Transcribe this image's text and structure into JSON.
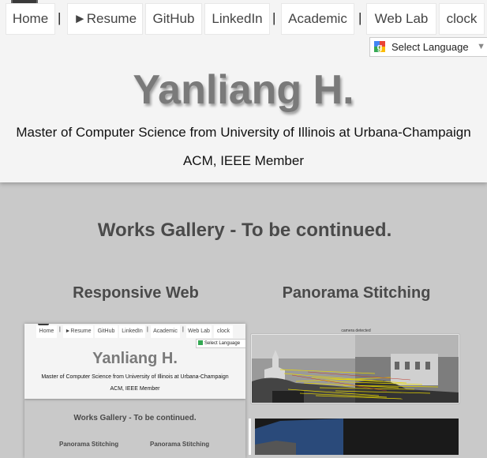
{
  "nav": {
    "items": [
      "Home",
      "►Resume",
      "GitHub",
      "LinkedIn",
      "Academic",
      "Web Lab",
      "clock"
    ],
    "separator": "|"
  },
  "language": {
    "label": "Select Language",
    "arrow": "▼"
  },
  "header": {
    "name": "Yanliang H.",
    "degree": "Master of Computer Science from University of Illinois at Urbana-Champaign",
    "member": "ACM, IEEE Member"
  },
  "gallery": {
    "title": "Works Gallery - To be continued.",
    "columns": [
      "Responsive Web",
      "Panorama Stitching"
    ]
  },
  "thumbnail_web": {
    "nav": [
      "Home",
      "►Resume",
      "GitHub",
      "LinkedIn",
      "Academic",
      "Web Lab",
      "clock"
    ],
    "language": "Select Language",
    "name": "Yanliang H.",
    "degree": "Master of Computer Science from University of Illinois at Urbana-Champaign",
    "member": "ACM, IEEE Member",
    "gallery_title": "Works Gallery - To be continued.",
    "columns": [
      "Panorama Stitching",
      "Panorama Stitching"
    ]
  },
  "thumbnail_pano": {
    "plot_title": "camera detected"
  },
  "colors": {
    "header_bg": "#f4f4f4",
    "page_bg": "#c9c9c9",
    "name_color": "#7a7a7a",
    "match_lines": "#e8d800"
  }
}
